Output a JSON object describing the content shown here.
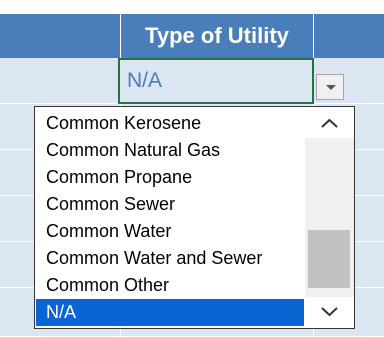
{
  "column": {
    "header": "Type of Utility"
  },
  "cell": {
    "value": "N/A"
  },
  "dropdown": {
    "options": [
      "Common Kerosene",
      "Common Natural Gas",
      "Common Propane",
      "Common Sewer",
      "Common Water",
      "Common Water and Sewer",
      "Common Other",
      "N/A"
    ],
    "selected": "N/A"
  },
  "colors": {
    "header_bg": "#4a7ebb",
    "row_band": "#dce6f2",
    "cell_border": "#217346",
    "selection": "#0a64d2"
  },
  "icons": {
    "scroll_up": "chevron-up-icon",
    "scroll_down": "chevron-down-icon",
    "dropdown": "dropdown-arrow-icon"
  }
}
